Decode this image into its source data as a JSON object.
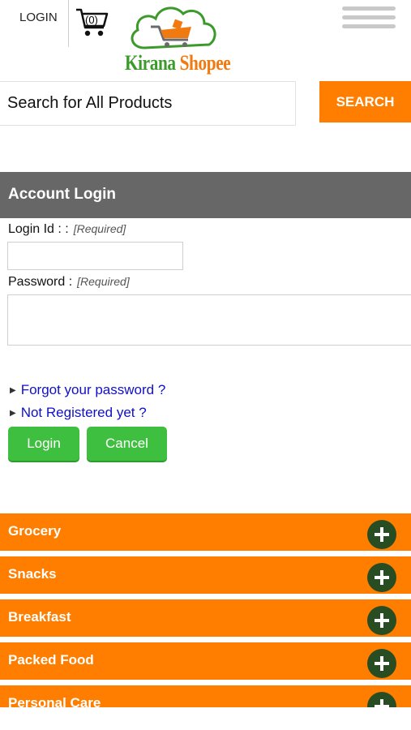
{
  "header": {
    "login_label": "LOGIN",
    "cart_count": "(0)",
    "logo_part1": "Kirana",
    "logo_part2": "Shopee",
    "brand_colors": {
      "green": "#3c9a2b",
      "orange": "#f07a10"
    }
  },
  "search": {
    "placeholder": "Search for All Products",
    "button_label": "SEARCH"
  },
  "account_login": {
    "title": "Account Login",
    "login_id_label": "Login Id : :",
    "login_id_hint": "[Required]",
    "password_label": "Password :",
    "password_hint": "[Required]",
    "forgot_link": "Forgot your password ?",
    "register_link": "Not Registered yet ?",
    "login_button": "Login",
    "cancel_button": "Cancel"
  },
  "categories": [
    {
      "label": "Grocery"
    },
    {
      "label": "Snacks"
    },
    {
      "label": "Breakfast"
    },
    {
      "label": "Packed Food"
    },
    {
      "label": "Personal Care"
    }
  ],
  "colors": {
    "accent_orange": "#ff7e00",
    "panel_gray": "#676767",
    "button_green": "#3fbf3f",
    "plus_dark_green": "#284d23",
    "link_blue": "#1010c8"
  }
}
